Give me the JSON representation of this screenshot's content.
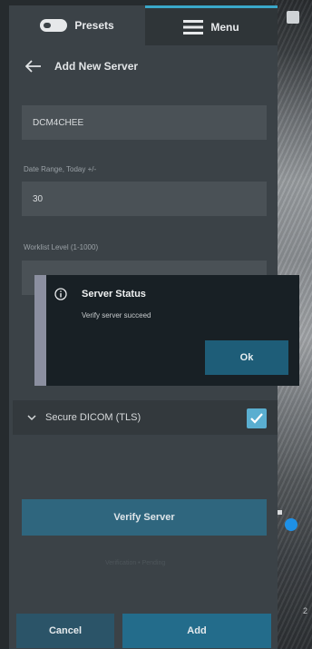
{
  "tabs": {
    "presets_label": "Presets",
    "menu_label": "Menu"
  },
  "header": {
    "title": "Add New Server"
  },
  "form": {
    "server_name_value": "DCM4CHEE",
    "date_range_label": "Date Range, Today +/-",
    "date_range_value": "30",
    "max_level_label": "Worklist Level (1-1000)"
  },
  "secure_dicom": {
    "label": "Secure DICOM (TLS)",
    "checked": true
  },
  "buttons": {
    "verify_label": "Verify Server",
    "cancel_label": "Cancel",
    "add_label": "Add"
  },
  "faint_text": "Verification • Pending",
  "dialog": {
    "title": "Server Status",
    "message": "Verify server succeed",
    "ok_label": "Ok"
  },
  "colors": {
    "accent": "#3aa7c9",
    "checkbox": "#5aaed0",
    "primary_button": "#236c8b",
    "dialog_bg": "#182025"
  },
  "icons": {
    "presets": "probe-icon",
    "menu": "hamburger-icon",
    "back": "arrow-left-icon",
    "info": "info-circle-icon",
    "chevron": "chevron-down-icon",
    "check": "checkmark-icon"
  }
}
